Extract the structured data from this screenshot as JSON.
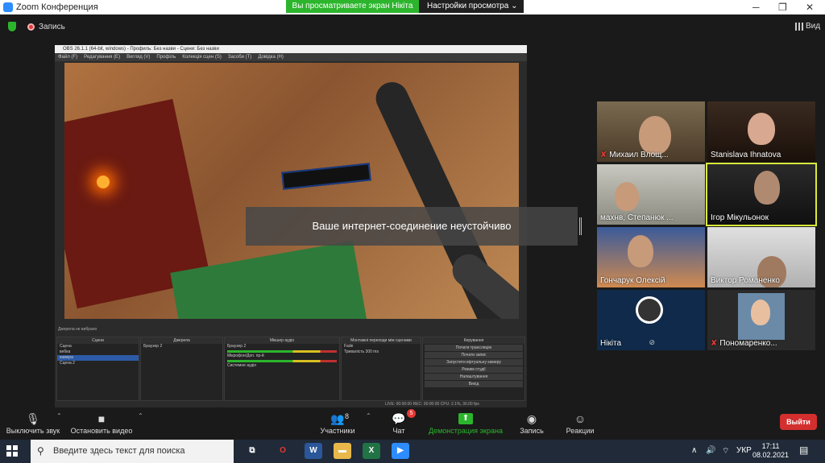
{
  "window": {
    "title": "Zoom Конференция"
  },
  "share_banner": {
    "text": "Вы просматриваете экран Нікіта",
    "view_options": "Настройки просмотра"
  },
  "topbar": {
    "record_label": "Запись",
    "view_label": "Вид"
  },
  "obs": {
    "title": "OBS 26.1.1 (64-bit, windows) - Профиль: Без назви - Сцени: Без назви",
    "menu": [
      "Файл (F)",
      "Редагування (E)",
      "Вигляд (V)",
      "Профіль",
      "Колекція сцен (S)",
      "Засоби (T)",
      "Довідка (H)"
    ],
    "status_no_source": "Джерела не вибрано",
    "docks": {
      "scenes": {
        "title": "Сцени",
        "items": [
          "Сцена",
          "вебка",
          "камера",
          "Сцена 2"
        ],
        "selected": 2
      },
      "sources": {
        "title": "Джерела",
        "items": [
          "Браузер 2"
        ]
      },
      "mixer": {
        "title": "Мікшер аудіо",
        "channels": [
          "Браузер 2",
          "Мікрофон/Доп. пр-й",
          "Системне аудіо"
        ]
      },
      "transitions": {
        "title": "Монтажні переходи між сценами",
        "type": "Fade",
        "duration_label": "Тривалість",
        "duration": "300 ms"
      },
      "controls": {
        "title": "Керування",
        "buttons": [
          "Почати трансляцію",
          "Почати запис",
          "Запустити віртуальну камеру",
          "Режим студії",
          "Налаштування",
          "Вихід"
        ]
      }
    },
    "statusbar": "LIVE: 00:00:00   REC: 00:00:00   CPU: 2.1%, 30.00 fps"
  },
  "toast": {
    "text": "Ваше интернет-соединение неустойчиво"
  },
  "participants": [
    {
      "name": "Михаил Влощ...",
      "muted": true
    },
    {
      "name": "Stanislava Ihnatova",
      "muted": false
    },
    {
      "name": "махнв, Степанюк ...",
      "muted": false
    },
    {
      "name": "Ігор Мікульонок",
      "muted": false,
      "active": true
    },
    {
      "name": "Гончарук Олексій",
      "muted": false
    },
    {
      "name": "Виктор Романенко",
      "muted": false
    },
    {
      "name": "Нікіта",
      "muted": false
    },
    {
      "name": "Пономаренко...",
      "muted": true
    }
  ],
  "toolbar": {
    "mute": "Выключить звук",
    "video": "Остановить видео",
    "participants": "Участники",
    "participants_count": "8",
    "chat": "Чат",
    "chat_badge": "5",
    "share": "Демонстрация экрана",
    "record": "Запись",
    "reactions": "Реакции",
    "exit": "Выйти"
  },
  "taskbar": {
    "search_placeholder": "Введите здесь текст для поиска",
    "lang": "УКР",
    "time": "17:11",
    "date": "08.02.2021"
  },
  "colors": {
    "share_green": "#2cb52c",
    "exit_red": "#d32f2f",
    "active_tile": "#d9e93a"
  }
}
